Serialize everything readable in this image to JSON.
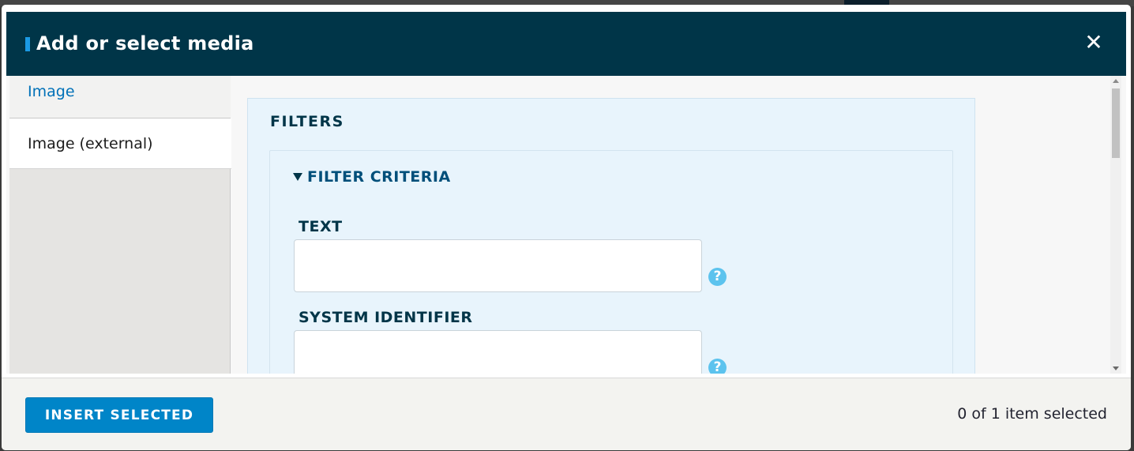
{
  "dialog": {
    "title": "Add or select media",
    "close_icon": "close-icon"
  },
  "sidebar": {
    "tabs": [
      {
        "label": "Image",
        "active": false
      },
      {
        "label": "Image (external)",
        "active": true
      }
    ]
  },
  "filters": {
    "heading": "FILTERS",
    "criteria": {
      "summary": "FILTER CRITERIA",
      "expanded": true,
      "fields": [
        {
          "label": "TEXT",
          "value": "",
          "help_icon": "help-icon"
        },
        {
          "label": "SYSTEM IDENTIFIER",
          "value": "",
          "help_icon": "help-icon"
        }
      ]
    }
  },
  "footer": {
    "insert_label": "INSERT SELECTED",
    "selection_status": "0 of 1 item selected"
  },
  "colors": {
    "titlebar": "#003548",
    "accent": "#1b9ae4",
    "primary_button": "#0085c8",
    "link": "#0071b8",
    "help_icon": "#5cc3ee"
  }
}
